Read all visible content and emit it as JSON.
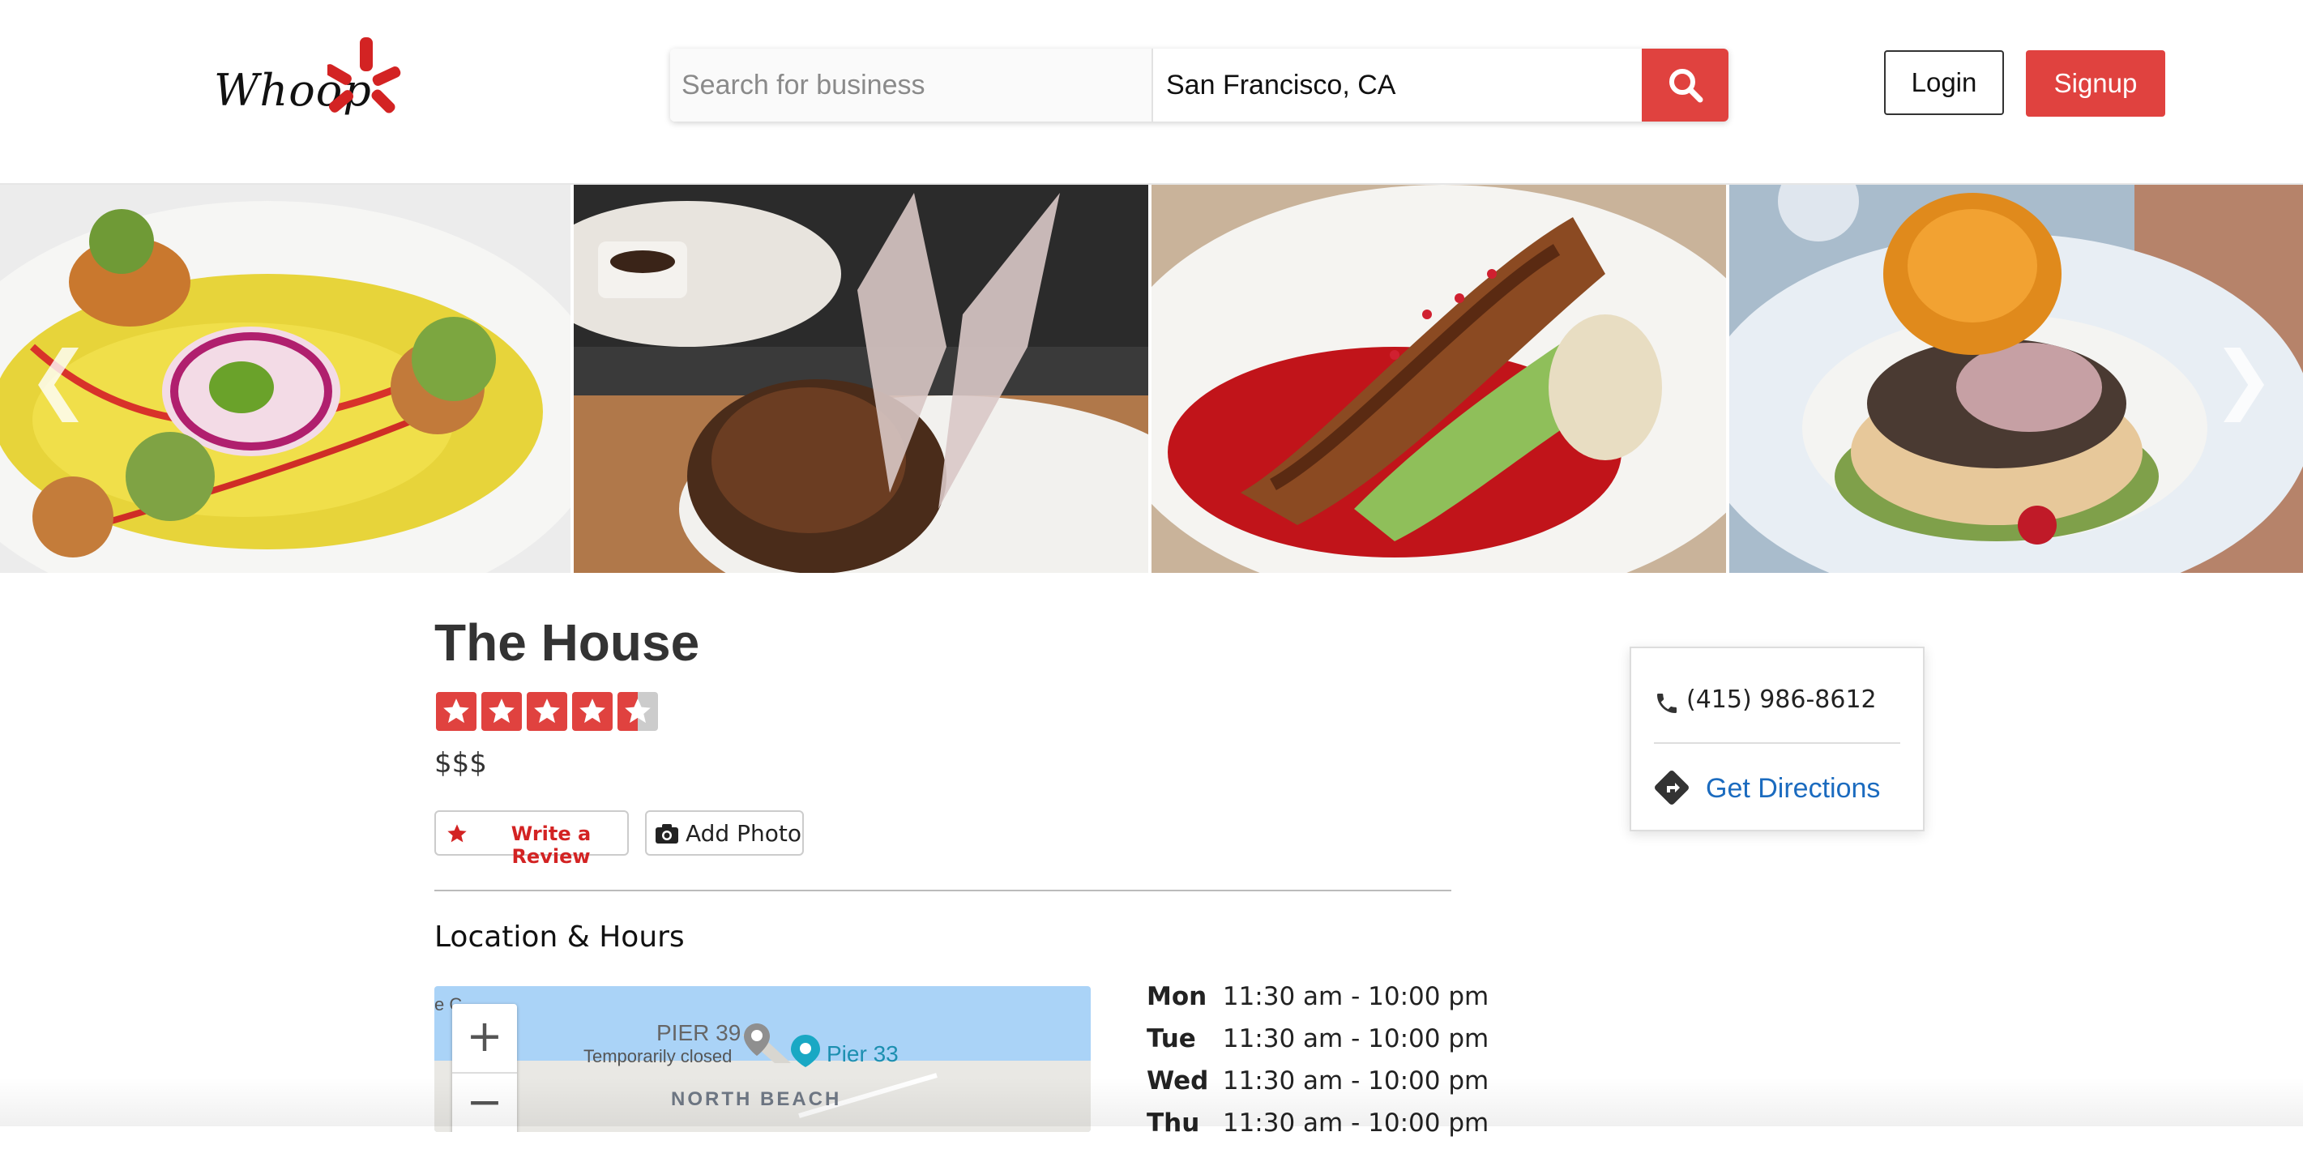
{
  "header": {
    "logo_text": "Whoop",
    "search_placeholder": "Search for business",
    "location_value": "San Francisco, CA",
    "search_icon": "search-icon",
    "login_label": "Login",
    "signup_label": "Signup"
  },
  "gallery": {
    "prev_arrow": "❮",
    "next_arrow": "❯",
    "photos": [
      "food-photo",
      "food-photo",
      "food-photo",
      "food-photo"
    ]
  },
  "business": {
    "name": "The House",
    "rating": 4.5,
    "rating_max": 5,
    "price": "$$$",
    "write_review_label": "Write a Review",
    "add_photo_label": "Add Photo"
  },
  "location": {
    "section_title": "Location & Hours",
    "map": {
      "zoom_in": "+",
      "zoom_out": "−",
      "labels": {
        "pier39": "PIER 39",
        "closed": "Temporarily closed",
        "pier33": "Pier 33",
        "north_beach": "NORTH BEACH"
      }
    },
    "hours": [
      {
        "day": "Mon",
        "time": "11:30 am - 10:00 pm"
      },
      {
        "day": "Tue",
        "time": "11:30 am - 10:00 pm"
      },
      {
        "day": "Wed",
        "time": "11:30 am - 10:00 pm"
      },
      {
        "day": "Thu",
        "time": "11:30 am - 10:00 pm"
      }
    ]
  },
  "sidebar": {
    "phone": "(415) 986-8612",
    "directions_label": "Get Directions"
  },
  "colors": {
    "brand_red": "#e0423f",
    "link_blue": "#1b6bbf",
    "star_empty": "#cccccc"
  }
}
